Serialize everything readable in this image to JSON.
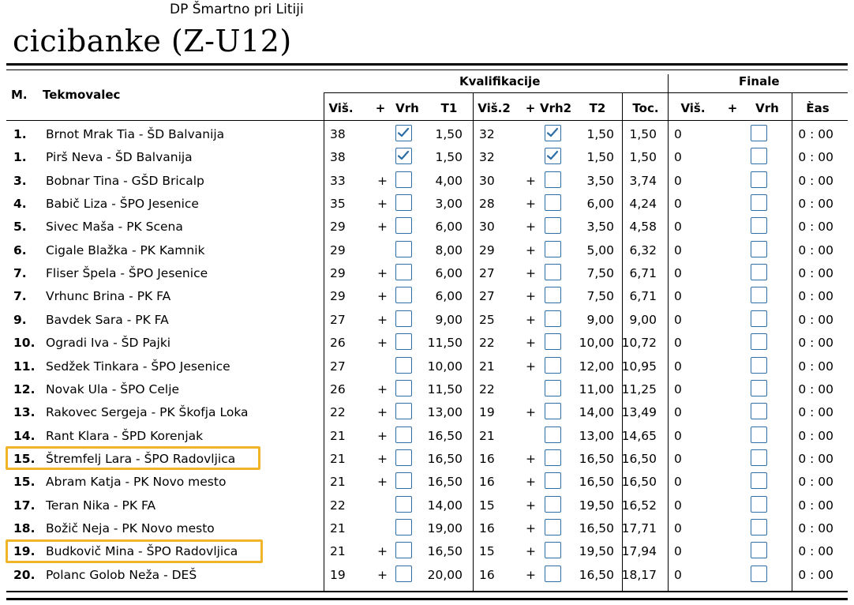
{
  "header": {
    "venue": "DP Šmartno pri Litiji",
    "category": "cicibanke (Z-U12)"
  },
  "columns": {
    "rank": "M.",
    "competitor": "Tekmovalec",
    "qualification": "Kvalifikacije",
    "finals": "Finale",
    "h1": "Viš.",
    "plus1": "+",
    "top1": "Vrh",
    "t1": "T1",
    "h2": "Viš.2",
    "plus2": "+",
    "top2": "Vrh2",
    "t2": "T2",
    "points": "Toc.",
    "fh": "Viš.",
    "fplus": "+",
    "ftop": "Vrh",
    "time": "Èas"
  },
  "rows": [
    {
      "rank": "1.",
      "name": "Brnot Mrak Tia - ŠD Balvanija",
      "h1": "38",
      "p1": "",
      "top1": true,
      "t1": "1,50",
      "h2": "32",
      "p2": "",
      "top2": true,
      "t2": "1,50",
      "pts": "1,50",
      "fh": "0",
      "time": "0 : 00",
      "highlight": false
    },
    {
      "rank": "1.",
      "name": "Pirš Neva - ŠD Balvanija",
      "h1": "38",
      "p1": "",
      "top1": true,
      "t1": "1,50",
      "h2": "32",
      "p2": "",
      "top2": true,
      "t2": "1,50",
      "pts": "1,50",
      "fh": "0",
      "time": "0 : 00",
      "highlight": false
    },
    {
      "rank": "3.",
      "name": "Bobnar Tina - GŠD Bricalp",
      "h1": "33",
      "p1": "+",
      "top1": false,
      "t1": "4,00",
      "h2": "30",
      "p2": "+",
      "top2": false,
      "t2": "3,50",
      "pts": "3,74",
      "fh": "0",
      "time": "0 : 00",
      "highlight": false
    },
    {
      "rank": "4.",
      "name": "Babič Liza - ŠPO Jesenice",
      "h1": "35",
      "p1": "+",
      "top1": false,
      "t1": "3,00",
      "h2": "28",
      "p2": "+",
      "top2": false,
      "t2": "6,00",
      "pts": "4,24",
      "fh": "0",
      "time": "0 : 00",
      "highlight": false
    },
    {
      "rank": "5.",
      "name": "Sivec Maša - PK Scena",
      "h1": "29",
      "p1": "+",
      "top1": false,
      "t1": "6,00",
      "h2": "30",
      "p2": "+",
      "top2": false,
      "t2": "3,50",
      "pts": "4,58",
      "fh": "0",
      "time": "0 : 00",
      "highlight": false
    },
    {
      "rank": "6.",
      "name": "Cigale Blažka - PK Kamnik",
      "h1": "29",
      "p1": "",
      "top1": false,
      "t1": "8,00",
      "h2": "29",
      "p2": "+",
      "top2": false,
      "t2": "5,00",
      "pts": "6,32",
      "fh": "0",
      "time": "0 : 00",
      "highlight": false
    },
    {
      "rank": "7.",
      "name": "Fliser Špela - ŠPO Jesenice",
      "h1": "29",
      "p1": "+",
      "top1": false,
      "t1": "6,00",
      "h2": "27",
      "p2": "+",
      "top2": false,
      "t2": "7,50",
      "pts": "6,71",
      "fh": "0",
      "time": "0 : 00",
      "highlight": false
    },
    {
      "rank": "7.",
      "name": "Vrhunc Brina - PK FA",
      "h1": "29",
      "p1": "+",
      "top1": false,
      "t1": "6,00",
      "h2": "27",
      "p2": "+",
      "top2": false,
      "t2": "7,50",
      "pts": "6,71",
      "fh": "0",
      "time": "0 : 00",
      "highlight": false
    },
    {
      "rank": "9.",
      "name": "Bavdek Sara - PK FA",
      "h1": "27",
      "p1": "+",
      "top1": false,
      "t1": "9,00",
      "h2": "25",
      "p2": "+",
      "top2": false,
      "t2": "9,00",
      "pts": "9,00",
      "fh": "0",
      "time": "0 : 00",
      "highlight": false
    },
    {
      "rank": "10.",
      "name": "Ogradi Iva - ŠD Pajki",
      "h1": "26",
      "p1": "+",
      "top1": false,
      "t1": "11,50",
      "h2": "22",
      "p2": "+",
      "top2": false,
      "t2": "10,00",
      "pts": "10,72",
      "fh": "0",
      "time": "0 : 00",
      "highlight": false
    },
    {
      "rank": "11.",
      "name": "Sedžek Tinkara - ŠPO Jesenice",
      "h1": "27",
      "p1": "",
      "top1": false,
      "t1": "10,00",
      "h2": "21",
      "p2": "+",
      "top2": false,
      "t2": "12,00",
      "pts": "10,95",
      "fh": "0",
      "time": "0 : 00",
      "highlight": false
    },
    {
      "rank": "12.",
      "name": "Novak Ula - ŠPO Celje",
      "h1": "26",
      "p1": "+",
      "top1": false,
      "t1": "11,50",
      "h2": "22",
      "p2": "",
      "top2": false,
      "t2": "11,00",
      "pts": "11,25",
      "fh": "0",
      "time": "0 : 00",
      "highlight": false
    },
    {
      "rank": "13.",
      "name": "Rakovec Sergeja - PK Škofja Loka",
      "h1": "22",
      "p1": "+",
      "top1": false,
      "t1": "13,00",
      "h2": "19",
      "p2": "+",
      "top2": false,
      "t2": "14,00",
      "pts": "13,49",
      "fh": "0",
      "time": "0 : 00",
      "highlight": false
    },
    {
      "rank": "14.",
      "name": "Rant Klara - ŠPD Korenjak",
      "h1": "21",
      "p1": "+",
      "top1": false,
      "t1": "16,50",
      "h2": "21",
      "p2": "",
      "top2": false,
      "t2": "13,00",
      "pts": "14,65",
      "fh": "0",
      "time": "0 : 00",
      "highlight": false
    },
    {
      "rank": "15.",
      "name": "Štremfelj Lara - ŠPO Radovljica",
      "h1": "21",
      "p1": "+",
      "top1": false,
      "t1": "16,50",
      "h2": "16",
      "p2": "+",
      "top2": false,
      "t2": "16,50",
      "pts": "16,50",
      "fh": "0",
      "time": "0 : 00",
      "highlight": true
    },
    {
      "rank": "15.",
      "name": "Abram Katja - PK Novo mesto",
      "h1": "21",
      "p1": "+",
      "top1": false,
      "t1": "16,50",
      "h2": "16",
      "p2": "+",
      "top2": false,
      "t2": "16,50",
      "pts": "16,50",
      "fh": "0",
      "time": "0 : 00",
      "highlight": false
    },
    {
      "rank": "17.",
      "name": "Teran Nika - PK FA",
      "h1": "22",
      "p1": "",
      "top1": false,
      "t1": "14,00",
      "h2": "15",
      "p2": "+",
      "top2": false,
      "t2": "19,50",
      "pts": "16,52",
      "fh": "0",
      "time": "0 : 00",
      "highlight": false
    },
    {
      "rank": "18.",
      "name": "Božič Neja - PK Novo mesto",
      "h1": "21",
      "p1": "",
      "top1": false,
      "t1": "19,00",
      "h2": "16",
      "p2": "+",
      "top2": false,
      "t2": "16,50",
      "pts": "17,71",
      "fh": "0",
      "time": "0 : 00",
      "highlight": false
    },
    {
      "rank": "19.",
      "name": "Budkovič Mina - ŠPO Radovljica",
      "h1": "21",
      "p1": "+",
      "top1": false,
      "t1": "16,50",
      "h2": "15",
      "p2": "+",
      "top2": false,
      "t2": "19,50",
      "pts": "17,94",
      "fh": "0",
      "time": "0 : 00",
      "highlight": true
    },
    {
      "rank": "20.",
      "name": "Polanc Golob Neža - DEŠ",
      "h1": "19",
      "p1": "+",
      "top1": false,
      "t1": "20,00",
      "h2": "16",
      "p2": "+",
      "top2": false,
      "t2": "16,50",
      "pts": "18,17",
      "fh": "0",
      "time": "0 : 00",
      "highlight": false
    }
  ],
  "colors": {
    "checkbox_border": "#2e6ea6",
    "highlight": "#f0b428"
  }
}
